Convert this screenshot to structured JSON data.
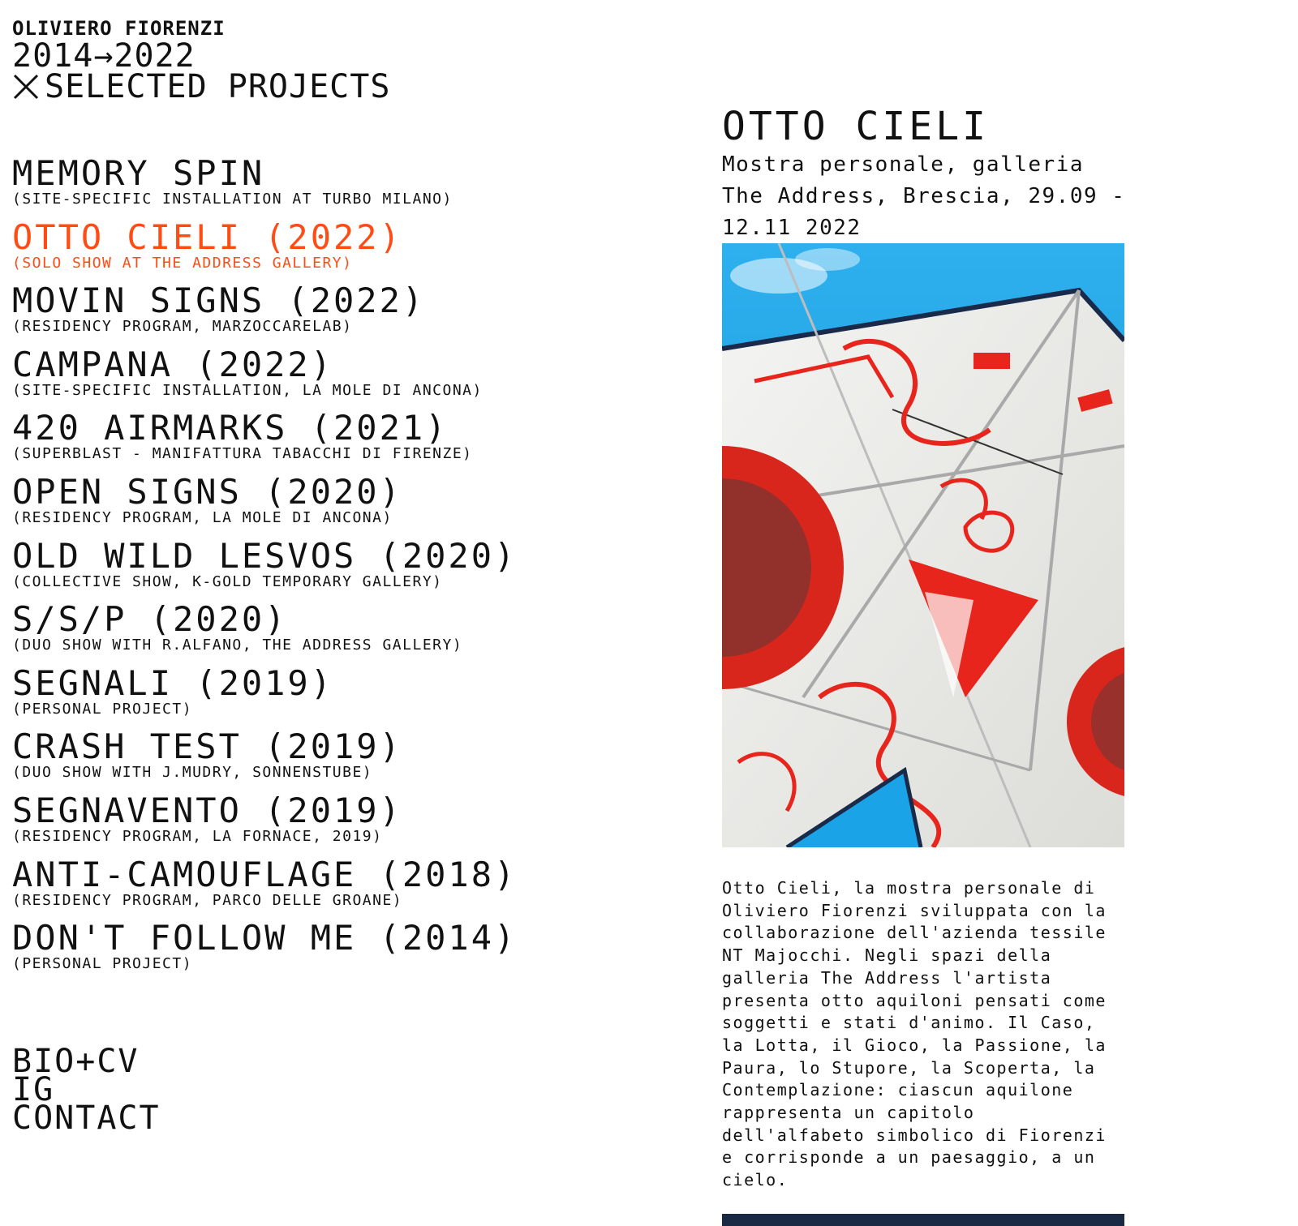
{
  "header": {
    "artist": "OLIVIERO FIORENZI",
    "years": "2014→2022",
    "section": "SELECTED PROJECTS",
    "section_icon": "close-x-icon"
  },
  "projects": [
    {
      "title": "MEMORY SPIN",
      "subtitle": "(SITE-SPECIFIC INSTALLATION AT TURBO MILANO)"
    },
    {
      "title": "OTTO CIELI (2022)",
      "subtitle": "(SOLO SHOW AT THE ADDRESS GALLERY)",
      "active": true
    },
    {
      "title": "MOVIN SIGNS (2022)",
      "subtitle": "(RESIDENCY PROGRAM, MARZOCCARELAB)"
    },
    {
      "title": "CAMPANA (2022)",
      "subtitle": "(SITE-SPECIFIC INSTALLATION, LA MOLE DI ANCONA)"
    },
    {
      "title": "420 AIRMARKS (2021)",
      "subtitle": "(SUPERBLAST - MANIFATTURA TABACCHI DI FIRENZE)"
    },
    {
      "title": "OPEN SIGNS (2020)",
      "subtitle": "(RESIDENCY PROGRAM, LA MOLE DI ANCONA)"
    },
    {
      "title": "OLD WILD LESVOS (2020)",
      "subtitle": "(COLLECTIVE SHOW, K-GOLD TEMPORARY GALLERY)"
    },
    {
      "title": "S/S/P (2020)",
      "subtitle": "(DUO SHOW WITH R.ALFANO, THE ADDRESS GALLERY)"
    },
    {
      "title": "SEGNALI (2019)",
      "subtitle": "(PERSONAL PROJECT)"
    },
    {
      "title": "CRASH TEST (2019)",
      "subtitle": "(DUO SHOW WITH J.MUDRY, SONNENSTUBE)"
    },
    {
      "title": "SEGNAVENTO (2019)",
      "subtitle": "(RESIDENCY PROGRAM, LA FORNACE, 2019)"
    },
    {
      "title": "ANTI-CAMOUFLAGE (2018)",
      "subtitle": "(RESIDENCY PROGRAM, PARCO DELLE GROANE)"
    },
    {
      "title": "DON'T FOLLOW ME (2014)",
      "subtitle": "(PERSONAL PROJECT)"
    }
  ],
  "footer_nav": {
    "bio": "BIO+CV",
    "ig": "IG",
    "contact": "CONTACT"
  },
  "detail": {
    "title": "OTTO CIELI",
    "subtitle": "Mostra personale, galleria The Address, Brescia, 29.09 - 12.11 2022",
    "description": "Otto Cieli, la mostra personale di Oliviero Fiorenzi sviluppata con la collaborazione dell'azienda tessile NT Majocchi. Negli spazi della galleria The Address l'artista presenta otto aquiloni pensati come soggetti e stati d'animo. Il Caso, la Lotta, il Gioco, la Passione, la Paura, lo Stupore, la Scoperta, la Contemplazione: ciascun aquilone rappresenta un capitolo dell'alfabeto simbolico di Fiorenzi e corrisponde a un paesaggio, a un cielo."
  },
  "colors": {
    "accent": "#ff4b14",
    "text": "#111111",
    "sky": "#1aa3e6",
    "kite_red": "#e8251c"
  }
}
